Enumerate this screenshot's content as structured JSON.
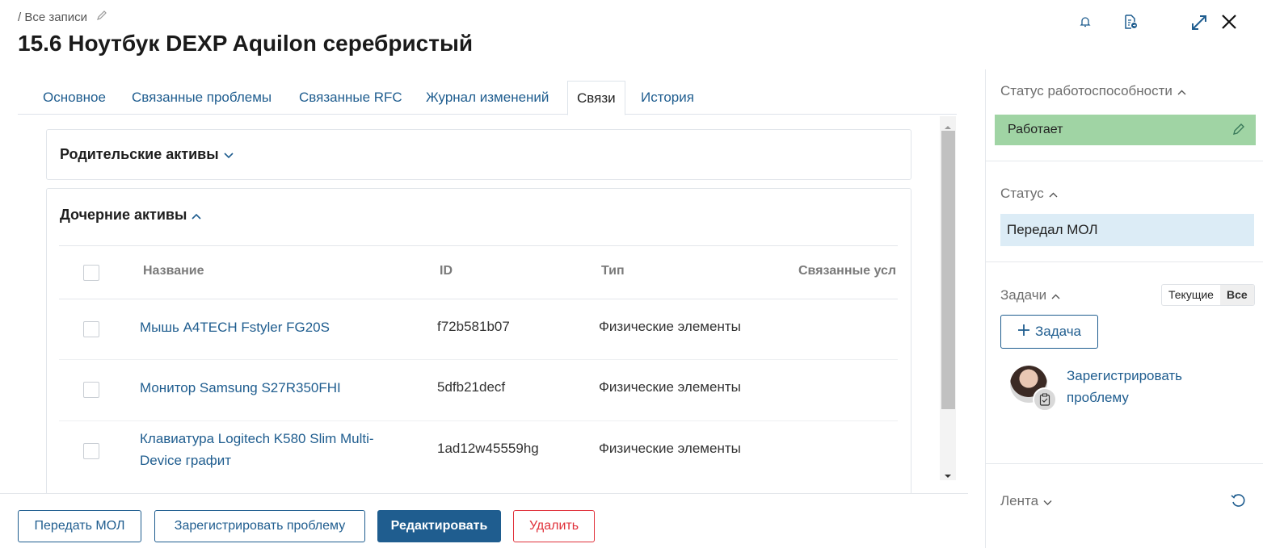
{
  "header": {
    "breadcrumb": "/ Все записи",
    "title": "15.6 Ноутбук DEXP Aquilon серебристый"
  },
  "tabs": [
    {
      "label": "Основное"
    },
    {
      "label": "Связанные проблемы"
    },
    {
      "label": "Связанные RFC"
    },
    {
      "label": "Журнал изменений"
    },
    {
      "label": "Связи"
    },
    {
      "label": "История"
    }
  ],
  "parent_assets": {
    "title": "Родительские активы"
  },
  "child_assets": {
    "title": "Дочерние активы",
    "columns": [
      "Название",
      "ID",
      "Тип",
      "Связанные усл"
    ],
    "rows": [
      {
        "name": "Мышь A4TECH Fstyler FG20S",
        "id": "f72b581b07",
        "type": "Физические элементы"
      },
      {
        "name": "Монитор Samsung S27R350FHI",
        "id": "5dfb21decf",
        "type": "Физические элементы"
      },
      {
        "name": "Клавиатура Logitech K580 Slim Multi-Device графит",
        "id": "1ad12w45559hg",
        "type": "Физические элементы"
      }
    ]
  },
  "footer": {
    "transfer_label": "Передать МОЛ",
    "register_label": "Зарегистрировать проблему",
    "edit_label": "Редактировать",
    "delete_label": "Удалить"
  },
  "sidebar": {
    "health_title": "Статус работоспособности",
    "health_value": "Работает",
    "status_title": "Статус",
    "status_value": "Передал МОЛ",
    "tasks_title": "Задачи",
    "toggle_current": "Текущие",
    "toggle_all": "Все",
    "add_task_label": "Задача",
    "task_item": "Зарегистрировать проблему",
    "feed_title": "Лента"
  },
  "colors": {
    "link": "#1f5d8f",
    "health_bg": "#a0d4a4",
    "status_bg": "#dcecf6",
    "danger": "#e0303a"
  }
}
